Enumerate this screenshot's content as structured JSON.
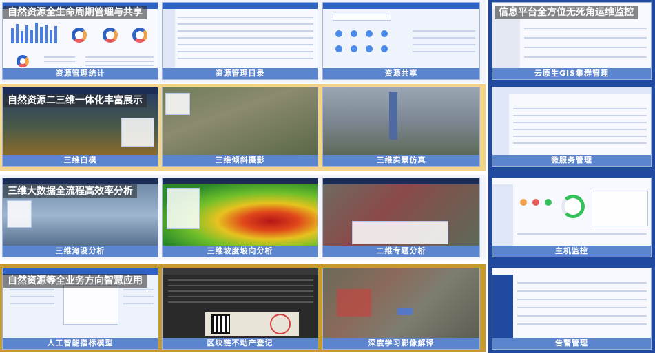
{
  "bands": [
    {
      "title": "自然资源全生命周期管理与共享"
    },
    {
      "title": "自然资源二三维一体化丰富展示"
    },
    {
      "title": "三维大数据全流程高效率分析"
    },
    {
      "title": "自然资源等全业务方向智慧应用"
    }
  ],
  "right_column": {
    "title": "信息平台全方位无死角运维监控"
  },
  "tiles": {
    "r1c1": "资源管理统计",
    "r1c2": "资源管理目录",
    "r1c3": "资源共享",
    "r2c1": "三维白模",
    "r2c2": "三维倾斜摄影",
    "r2c3": "三维实景仿真",
    "r3c1": "三维淹没分析",
    "r3c2": "三维坡度坡向分析",
    "r3c3": "二维专题分析",
    "r4c1": "人工智能指标模型",
    "r4c2": "区块链不动产登记",
    "r4c3": "深度学习影像解译",
    "rc1": "云原生GIS集群管理",
    "rc2": "微服务管理",
    "rc3": "主机监控",
    "rc4": "告警管理"
  },
  "colors": {
    "caption": "#5b85cf",
    "band_gold": "#f3d58a",
    "right_blue": "#1f4aa0"
  }
}
